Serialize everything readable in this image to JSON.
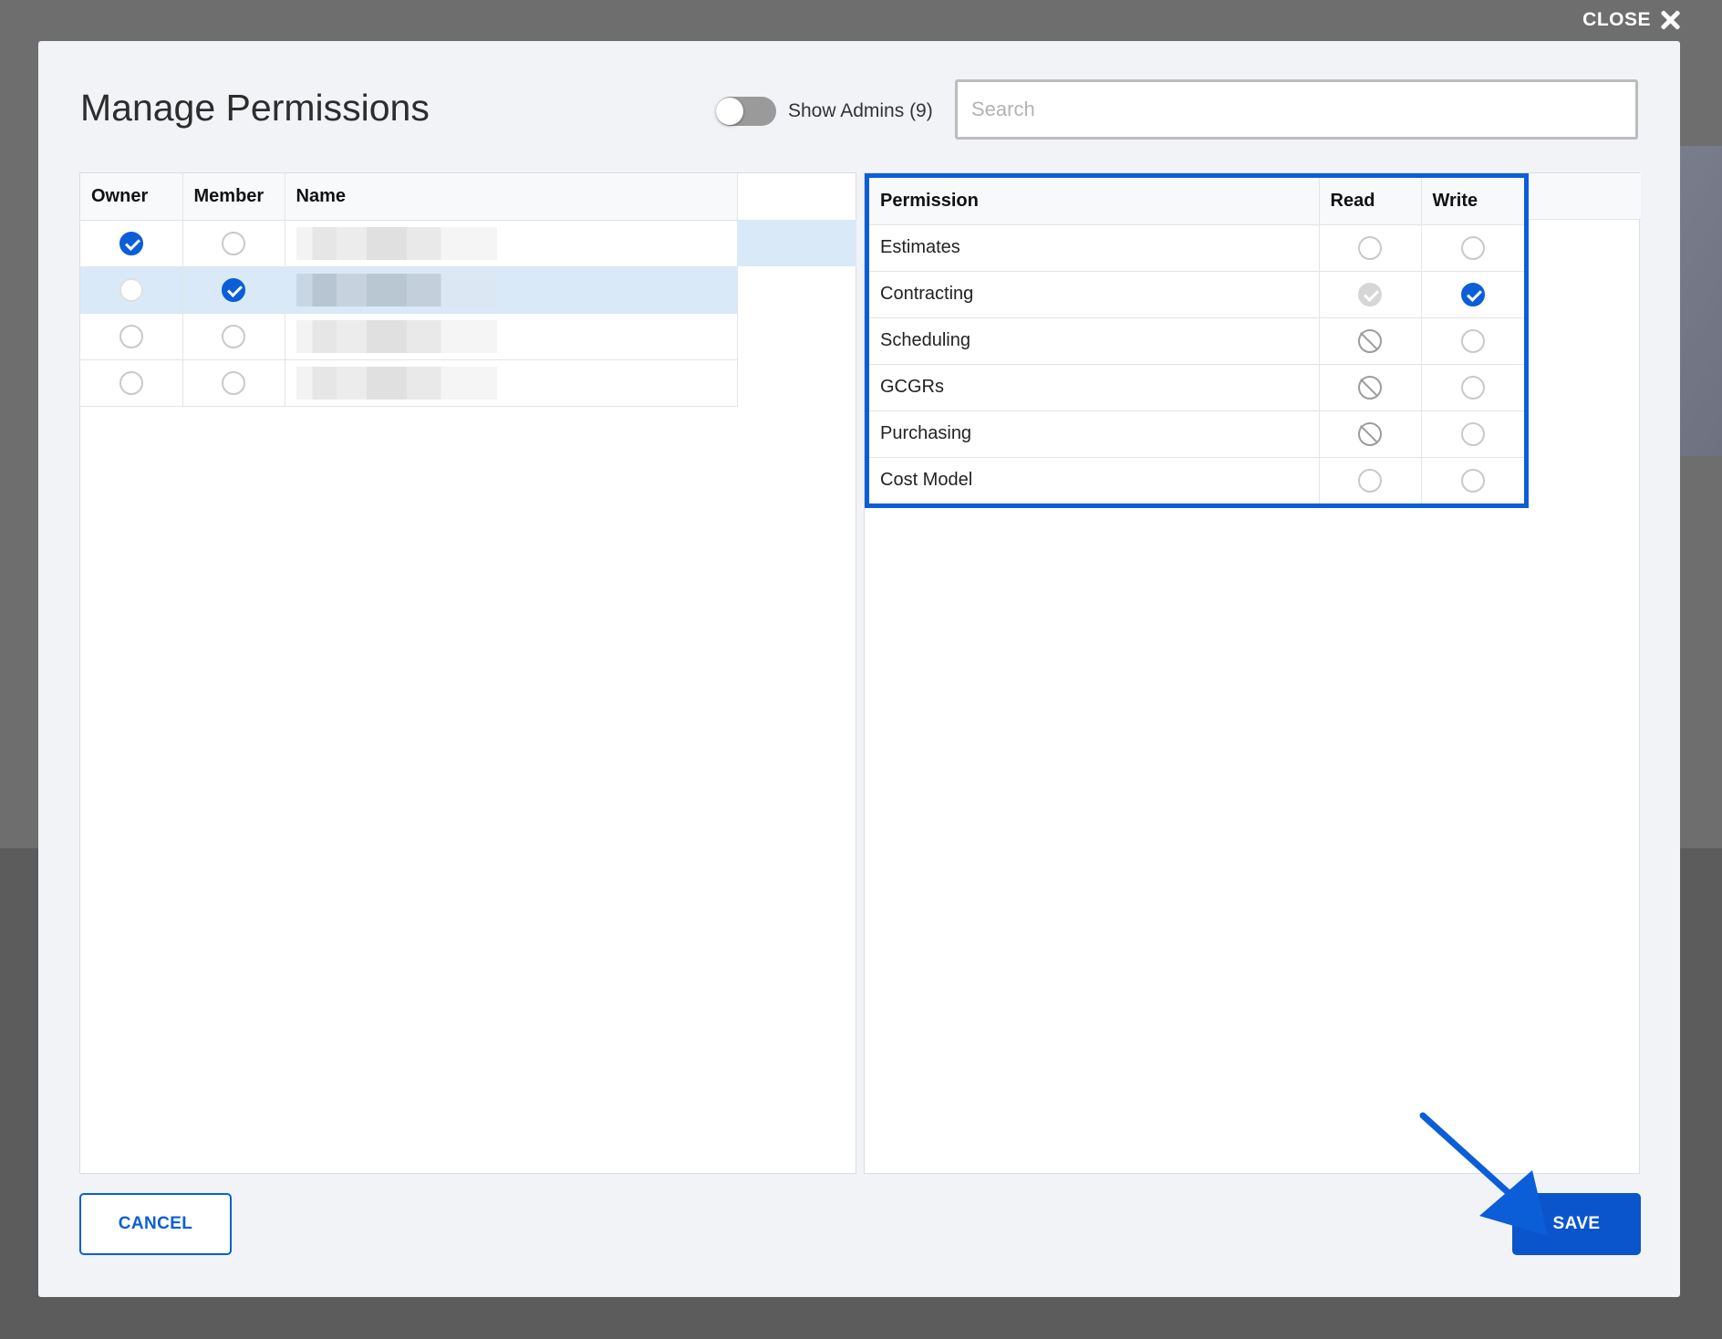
{
  "close": {
    "label": "CLOSE"
  },
  "modal": {
    "title": "Manage Permissions",
    "toggle_label": "Show Admins (9)",
    "toggle_on": false,
    "search_placeholder": "Search"
  },
  "users": {
    "columns": [
      "Owner",
      "Member",
      "Name"
    ],
    "rows": [
      {
        "owner": "checked",
        "member": "unchecked",
        "selected": false
      },
      {
        "owner": "faded",
        "member": "checked",
        "selected": true
      },
      {
        "owner": "unchecked",
        "member": "unchecked",
        "selected": false
      },
      {
        "owner": "unchecked",
        "member": "unchecked",
        "selected": false
      }
    ]
  },
  "permissions": {
    "columns": [
      "Permission",
      "Read",
      "Write"
    ],
    "rows": [
      {
        "name": "Estimates",
        "read": "unchecked",
        "write": "unchecked"
      },
      {
        "name": "Contracting",
        "read": "grey-check",
        "write": "checked"
      },
      {
        "name": "Scheduling",
        "read": "blocked",
        "write": "unchecked"
      },
      {
        "name": "GCGRs",
        "read": "blocked",
        "write": "unchecked"
      },
      {
        "name": "Purchasing",
        "read": "blocked",
        "write": "unchecked"
      },
      {
        "name": "Cost Model",
        "read": "unchecked",
        "write": "unchecked"
      }
    ]
  },
  "footer": {
    "cancel_label": "CANCEL",
    "save_label": "SAVE"
  },
  "colors": {
    "accent": "#0b5ed7",
    "save": "#0b55cc",
    "selected_row": "#d9e9f8"
  }
}
